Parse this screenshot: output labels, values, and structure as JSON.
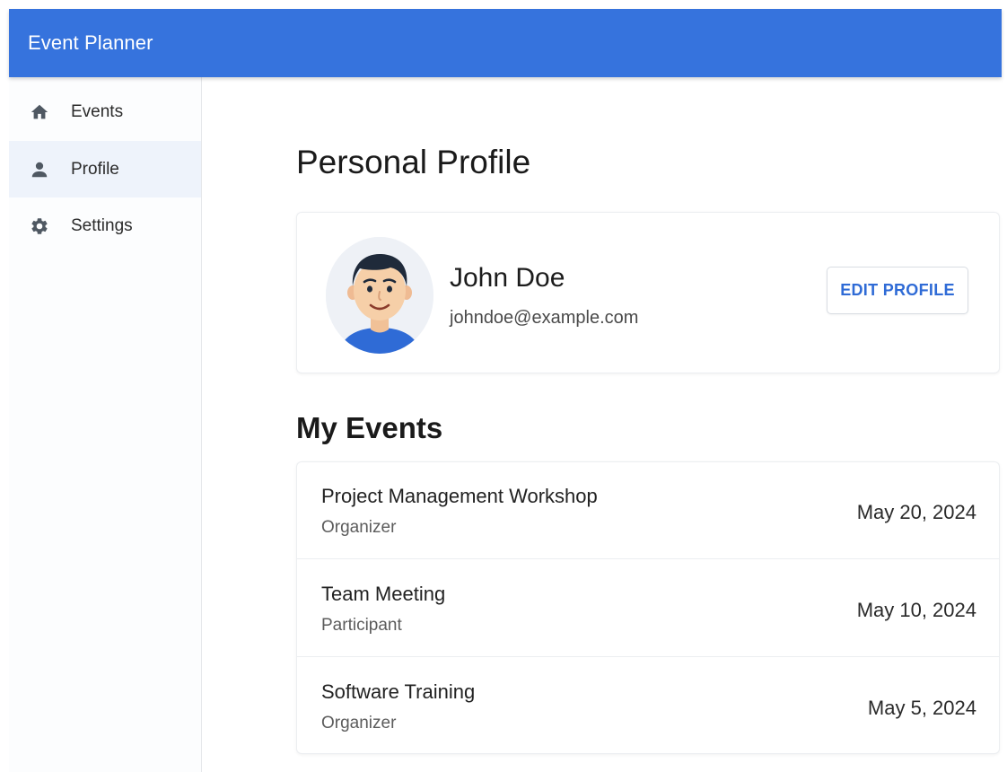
{
  "app": {
    "title": "Event Planner"
  },
  "sidebar": {
    "items": [
      {
        "label": "Events",
        "icon": "home-icon",
        "active": false
      },
      {
        "label": "Profile",
        "icon": "person-icon",
        "active": true
      },
      {
        "label": "Settings",
        "icon": "gear-icon",
        "active": false
      }
    ]
  },
  "main": {
    "page_title": "Personal Profile",
    "profile": {
      "name": "John Doe",
      "email": "johndoe@example.com",
      "edit_label": "EDIT PROFILE"
    },
    "events_title": "My Events",
    "events": [
      {
        "name": "Project Management Workshop",
        "role": "Organizer",
        "date": "May 20, 2024"
      },
      {
        "name": "Team Meeting",
        "role": "Participant",
        "date": "May 10, 2024"
      },
      {
        "name": "Software Training",
        "role": "Organizer",
        "date": "May 5, 2024"
      }
    ]
  },
  "colors": {
    "primary": "#3673dd",
    "active_nav_bg": "#eef3fb",
    "button_text": "#2f6bd6"
  }
}
